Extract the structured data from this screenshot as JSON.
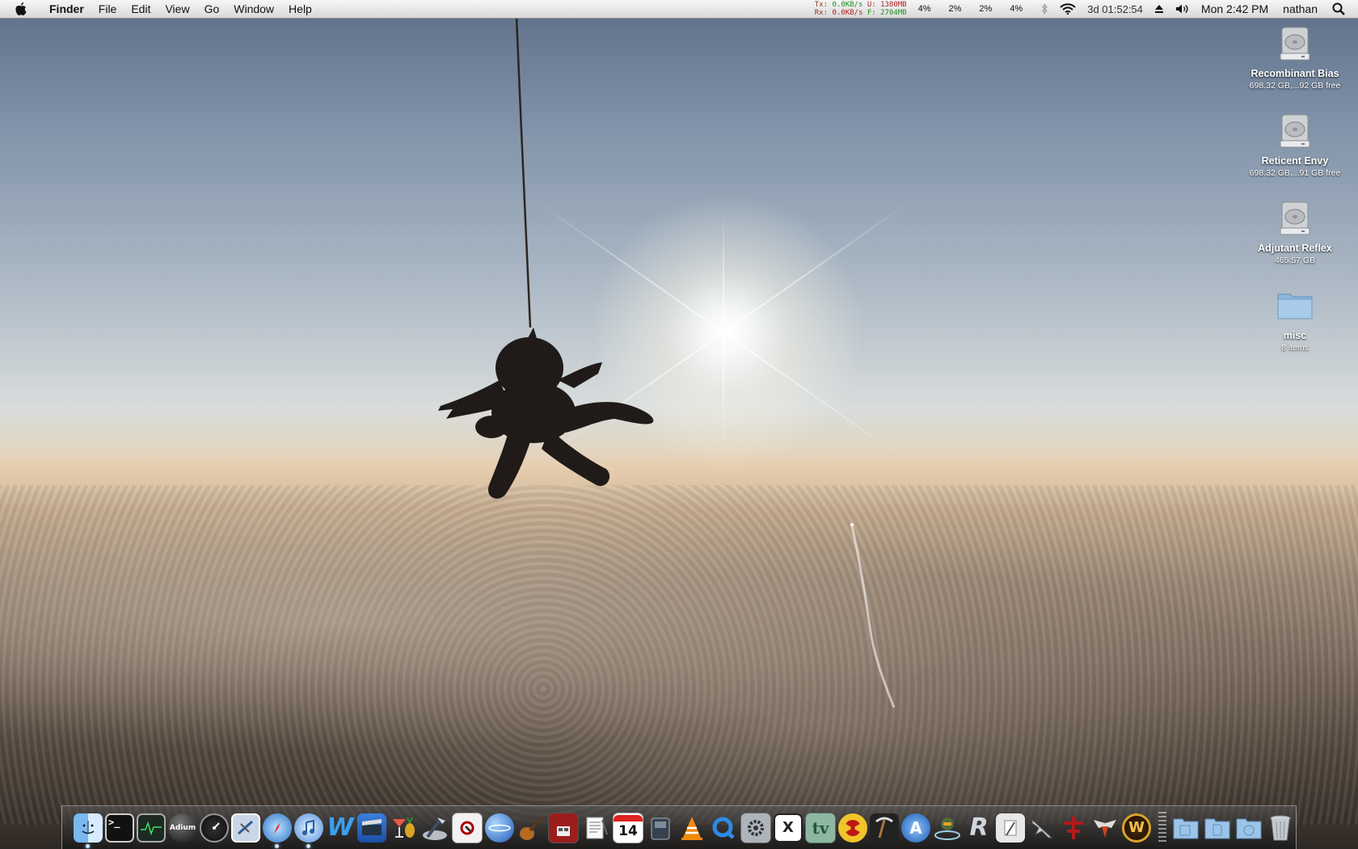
{
  "menubar": {
    "app_name": "Finder",
    "menus": [
      "File",
      "Edit",
      "View",
      "Go",
      "Window",
      "Help"
    ],
    "network": {
      "tx_label": "Tx:",
      "tx_value": "0.0KB/s",
      "rx_label": "Rx:",
      "rx_value": "0.0KB/s",
      "mem_used": "U: 1380MB",
      "mem_free": "F: 2704MB"
    },
    "cpu_cores": [
      "4%",
      "2%",
      "2%",
      "4%"
    ],
    "uptime": "3d 01:52:54",
    "clock": "Mon 2:42 PM",
    "user": "nathan"
  },
  "desktop_icons": [
    {
      "name": "Recombinant Bias",
      "sub": "698.32 GB,...92 GB free",
      "icon": "hard-drive-icon"
    },
    {
      "name": "Reticent Envy",
      "sub": "698.32 GB,...91 GB free",
      "icon": "hard-drive-icon"
    },
    {
      "name": "Adjutant Reflex",
      "sub": "465.57 GB",
      "icon": "hard-drive-icon"
    },
    {
      "name": "misc",
      "sub": "8 items",
      "icon": "folder-icon"
    }
  ],
  "dock": {
    "calendar_day": "14",
    "adium_label": "Adium"
  }
}
